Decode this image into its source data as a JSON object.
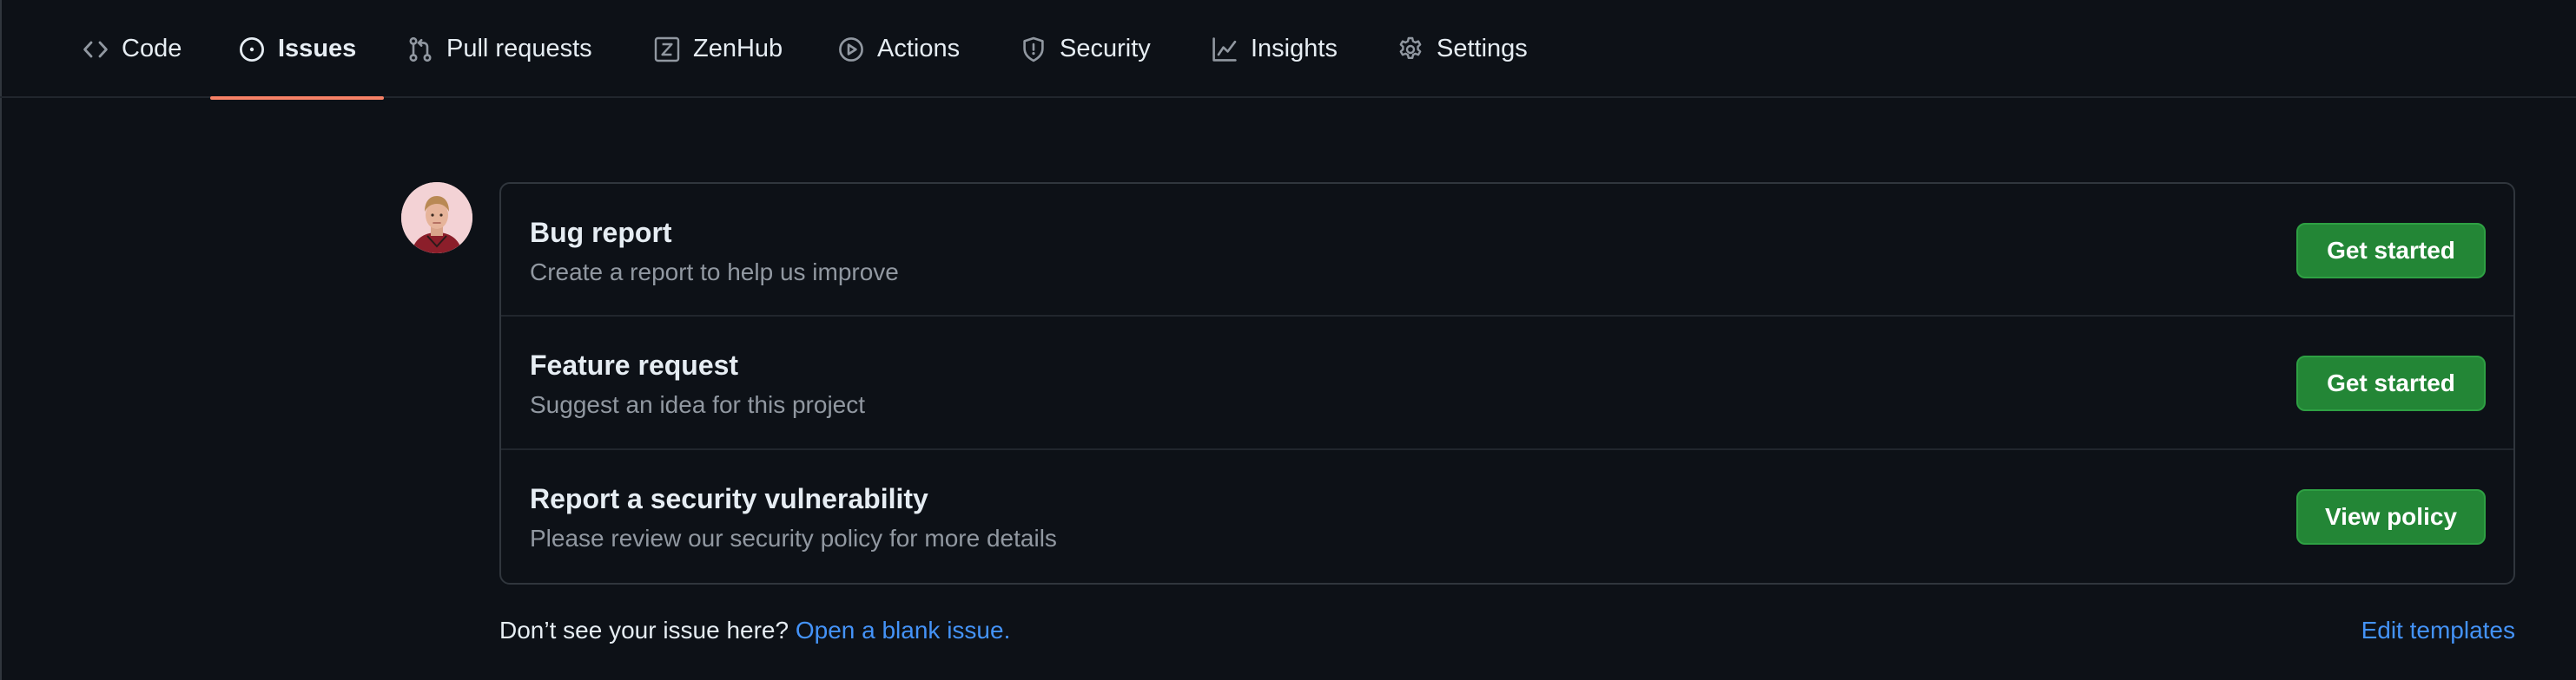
{
  "nav": {
    "tabs": [
      {
        "label": "Code",
        "icon": "code-icon"
      },
      {
        "label": "Issues",
        "icon": "issue-opened-icon",
        "selected": true
      },
      {
        "label": "Pull requests",
        "icon": "git-pull-request-icon"
      },
      {
        "label": "ZenHub",
        "icon": "zenhub-icon"
      },
      {
        "label": "Actions",
        "icon": "play-icon"
      },
      {
        "label": "Security",
        "icon": "shield-icon"
      },
      {
        "label": "Insights",
        "icon": "graph-icon"
      },
      {
        "label": "Settings",
        "icon": "gear-icon"
      }
    ]
  },
  "templates": [
    {
      "title": "Bug report",
      "description": "Create a report to help us improve",
      "button": "Get started"
    },
    {
      "title": "Feature request",
      "description": "Suggest an idea for this project",
      "button": "Get started"
    },
    {
      "title": "Report a security vulnerability",
      "description": "Please review our security policy for more details",
      "button": "View policy"
    }
  ],
  "footer": {
    "prompt": "Don’t see your issue here?",
    "blank_issue_link": "Open a blank issue.",
    "edit_templates_link": "Edit templates"
  },
  "colors": {
    "background": "#0d1117",
    "border": "#30363d",
    "text_primary": "#e6edf3",
    "text_muted": "#9198a1",
    "link": "#4493f8",
    "button_green": "#238636",
    "selected_underline": "#f78166"
  }
}
